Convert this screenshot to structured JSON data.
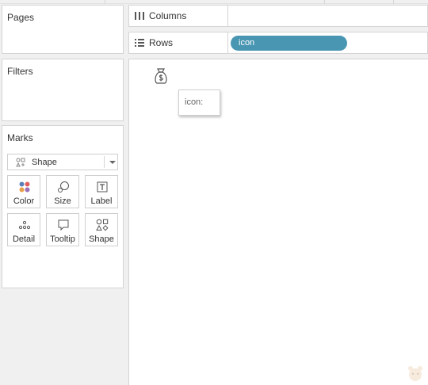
{
  "panels": {
    "pages_title": "Pages",
    "filters_title": "Filters",
    "marks_title": "Marks"
  },
  "marks": {
    "mark_type": "Shape",
    "buttons": [
      {
        "label": "Color",
        "icon": "color-dots-icon"
      },
      {
        "label": "Size",
        "icon": "size-circles-icon"
      },
      {
        "label": "Label",
        "icon": "label-text-icon"
      },
      {
        "label": "Detail",
        "icon": "detail-dots-icon"
      },
      {
        "label": "Tooltip",
        "icon": "tooltip-bubble-icon"
      },
      {
        "label": "Shape",
        "icon": "shapes-icon"
      }
    ],
    "colors": {
      "dot_blue": "#5b7fb8",
      "dot_red": "#e06060",
      "dot_orange": "#e8a048",
      "dot_purple": "#9a70b8"
    }
  },
  "shelves": {
    "columns_label": "Columns",
    "rows_label": "Rows",
    "rows_pill": "icon",
    "pill_color": "#4996b2"
  },
  "view": {
    "tooltip_text": "icon:",
    "mark_icon": "money-bag-icon"
  }
}
